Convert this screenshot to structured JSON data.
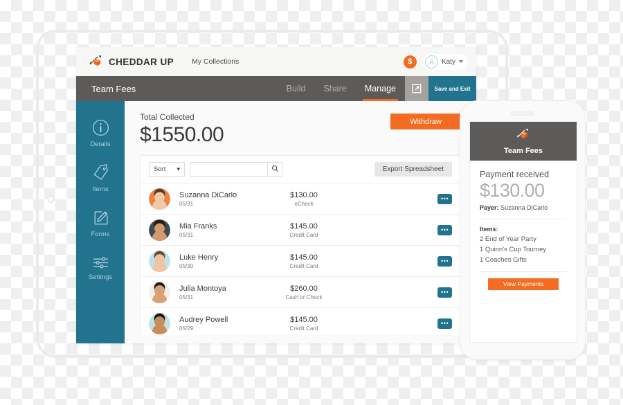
{
  "appbar": {
    "brand_name": "CHEDDAR UP",
    "brand_icon": "cheddar-cube-arrow-logo",
    "nav_link": "My Collections",
    "balance_icon": "dollar-coin-icon",
    "balance_symbol": "$",
    "user_name": "Katy",
    "user_avatar_icon": "user-avatar-icon",
    "caret_icon": "chevron-down-icon"
  },
  "tabbar": {
    "title": "Team Fees",
    "tabs": [
      {
        "label": "Build",
        "active": false
      },
      {
        "label": "Share",
        "active": false
      },
      {
        "label": "Manage",
        "active": true
      }
    ],
    "preview_icon": "external-link-icon",
    "save_exit_label": "Save and Exit"
  },
  "sidebar": {
    "items": [
      {
        "label": "Details",
        "icon": "info-circle-icon"
      },
      {
        "label": "Items",
        "icon": "tag-icon"
      },
      {
        "label": "Forms",
        "icon": "pencil-form-icon"
      },
      {
        "label": "Settings",
        "icon": "sliders-icon"
      }
    ]
  },
  "main": {
    "total_label": "Total Collected",
    "total_amount": "$1550.00",
    "withdraw_label": "Withdraw",
    "sort_label": "Sort",
    "sort_icon": "up-down-stepper-icon",
    "search_value": "",
    "search_placeholder": "",
    "search_icon": "search-icon",
    "export_label": "Export Spreadsheet",
    "row_menu_glyph": "•••",
    "row_menu_icon": "ellipsis-menu-icon",
    "payments": [
      {
        "name": "Suzanna DiCarlo",
        "date": "05/31",
        "amount": "$130.00",
        "method": "eCheck",
        "avatar_bg": "#f1813f",
        "skin": "#f0c9a8",
        "hair": "#5b3a28"
      },
      {
        "name": "Mia Franks",
        "date": "05/31",
        "amount": "$145.00",
        "method": "Credit Card",
        "avatar_bg": "#3c4a52",
        "skin": "#d39a6e",
        "hair": "#241a16"
      },
      {
        "name": "Luke Henry",
        "date": "05/30",
        "amount": "$145.00",
        "method": "Credit Card",
        "avatar_bg": "#bde3ec",
        "skin": "#eec4a4",
        "hair": "#6b4a33"
      },
      {
        "name": "Julia Montoya",
        "date": "05/31",
        "amount": "$260.00",
        "method": "Cash or Check",
        "avatar_bg": "#efefef",
        "skin": "#d9a275",
        "hair": "#2a2018"
      },
      {
        "name": "Audrey Powell",
        "date": "05/29",
        "amount": "$145.00",
        "method": "Credit Card",
        "avatar_bg": "#bde3ec",
        "skin": "#c98c5c",
        "hair": "#20150f"
      }
    ]
  },
  "phone": {
    "header_title": "Team Fees",
    "header_icon": "cheddar-cube-arrow-logo",
    "heading": "Payment received",
    "amount": "$130.00",
    "payer_label": "Payer:",
    "payer_name": "Suzanna DiCarlo",
    "items_label": "Items:",
    "items": [
      "2 End of Year Party",
      "1 Quinn's Cup Tourney",
      "1 Coaches Gifts"
    ],
    "view_payments_label": "View Payments"
  },
  "colors": {
    "brand_orange": "#f36c22",
    "teal": "#22738e",
    "dark_gray": "#5d5b59",
    "light_gray": "#a5a2a0"
  }
}
